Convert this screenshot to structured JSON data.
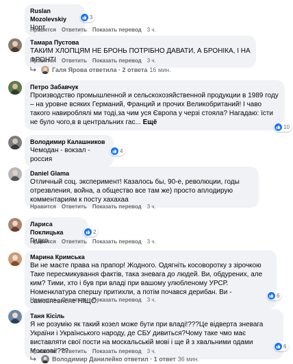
{
  "actions": {
    "like": "Нравится",
    "reply": "Ответить",
    "translate": "Показать перевод",
    "time_3h": "3 ч."
  },
  "comments": [
    {
      "author": "Ruslan Mozolevskiy",
      "text": "Чорт",
      "reactions": "3"
    },
    {
      "author": "Тамара Пустова",
      "text": "ТАКИМ ХЛОПЦЯМ НЕ БРОНЬ ПОТРІБНО ДАВАТИ, А БРОНІКА, І НА ФРОНТ!"
    },
    {
      "author": "Петро Забавчук",
      "text": "Производство промышленной и сельскохозяйственной продукции в 1989 году – на уровне всяких Германий, Франций и прочих Великобританий! І чаво такого навироблялі ми тоді,за чим уся Європа у черзі стояла? Нагадаю: їсти не було чого,в в центральних гас...",
      "more": "Ещё",
      "reactions": "10"
    },
    {
      "author": "Володимир Калашников",
      "text": "Чемодан - вокзал - россия",
      "reactions": "4"
    },
    {
      "author": "Daniel Glama",
      "text": "Отличный соц. эксперимент! Казалось бы, 90-е, революции, годы отрезвления, война, а общество все там же) просто аплодирую комментариям к посту хахахаа"
    },
    {
      "author": "Лариса Поклицька",
      "text": "Гидко.",
      "reactions": "2"
    },
    {
      "author": "Марина Кримська",
      "text": "Ви не маєте права на прапор! Жодного. Одягніть косоворотку з зірочкою Таке пересмикування фактів, така зневага до людей. Ви, обдурених, але ким? Тими, хто і був при владі при вашому улюбленому УРСР. Номенклатура спершу притихли, а потім почався дерибан. Ви - самовпевнене НІЩО.",
      "reactions": "6"
    },
    {
      "author": "Таня Кісіль",
      "text": "Я не розумію як такий козел може бути при владі!???Це відверта зневага України і Українського народу, де СБУ дивиться?Чому таке чмо має виставляти свої пости на москальській мові і ще й з хвальними одами Москові!???",
      "reactions": "6"
    }
  ],
  "replies": [
    {
      "name": "Галя Ярова ответила",
      "count": "· 2 ответа",
      "time": "16 мин."
    },
    {
      "name": "Володимир Данилейко ответил",
      "count": "· 1 ответ",
      "time": "36 мин."
    }
  ],
  "colors": {
    "bubble": "#f0f2f5",
    "like": "#1877f2",
    "meta": "#65676b"
  }
}
